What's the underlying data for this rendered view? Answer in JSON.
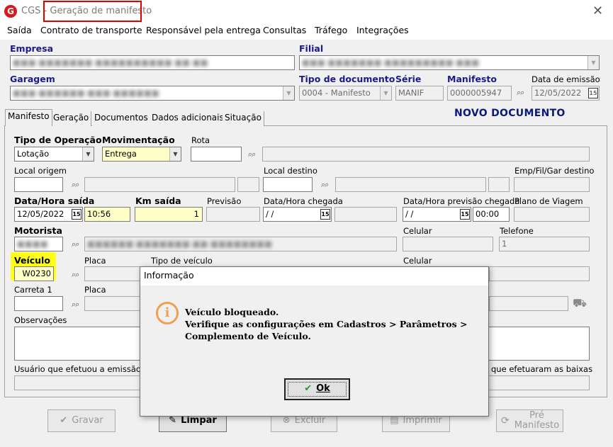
{
  "window": {
    "app": "CGS",
    "title": "Geração de manifesto",
    "close_glyph": "✕"
  },
  "menu": [
    "Saída",
    "Contrato de transporte",
    "Responsável pela entrega",
    "Consultas",
    "Tráfego",
    "Integrações"
  ],
  "header": {
    "empresa_label": "Empresa",
    "filial_label": "Filial",
    "garagem_label": "Garagem",
    "tipo_doc_label": "Tipo de documento",
    "tipo_doc_value": "0004 - Manifesto",
    "serie_label": "Série",
    "serie_value": "MANIF",
    "manifesto_label": "Manifesto",
    "manifesto_value": "0000005947",
    "data_emissao_label": "Data de emissão",
    "data_emissao_value": "12/05/2022"
  },
  "tabs": [
    "Manifesto",
    "Geração",
    "Documentos",
    "Dados adicionais",
    "Situação"
  ],
  "status": "NOVO DOCUMENTO",
  "form": {
    "tipo_operacao_label": "Tipo de Operação",
    "tipo_operacao_value": "Lotação",
    "movimentacao_label": "Movimentação",
    "movimentacao_value": "Entrega",
    "rota_label": "Rota",
    "local_origem_label": "Local origem",
    "local_destino_label": "Local destino",
    "emp_fil_gar_label": "Emp/Fil/Gar destino",
    "data_saida_label": "Data/Hora saída",
    "data_saida_value": "12/05/2022",
    "hora_saida_value": "10:56",
    "km_saida_label": "Km saída",
    "km_saida_value": "1",
    "previsao_label": "Previsão",
    "data_chegada_label": "Data/Hora chegada",
    "data_chegada_value": " / /",
    "data_prev_chegada_label": "Data/Hora previsão chegada",
    "data_prev_chegada_value": " / /",
    "hora_prev_chegada_value": "00:00",
    "plano_viagem_label": "Plano de Viagem",
    "motorista_label": "Motorista",
    "celular_label": "Celular",
    "telefone_label": "Telefone",
    "telefone_value": "1",
    "veiculo_label": "Veículo",
    "veiculo_value": "W0230",
    "placa_label": "Placa",
    "tipo_veiculo_label": "Tipo de veículo",
    "celular2_label": "Celular",
    "carreta_label": "Carreta 1",
    "placa2_label": "Placa",
    "observacoes_label": "Observações",
    "usuario_label": "Usuário que efetuou a emissão",
    "baixas_label": "que efetuaram as baixas"
  },
  "buttons": {
    "gravar": "Gravar",
    "limpar": "Limpar",
    "excluir": "Excluir",
    "imprimir": "Imprimir",
    "pre_manifesto_1": "Pré",
    "pre_manifesto_2": "Manifesto"
  },
  "dialog": {
    "title": "Informação",
    "icon": "info-icon",
    "line1": "Veículo bloqueado.",
    "line2": "Verifique as configurações em Cadastros > Parâmetros >",
    "line3": "Complemento de Veículo.",
    "ok": "Ok"
  },
  "colors": {
    "highlight": "#ffff1a",
    "annotation_red": "#e00000",
    "status_blue": "#0a1a7c",
    "info_orange": "#f0a050"
  }
}
